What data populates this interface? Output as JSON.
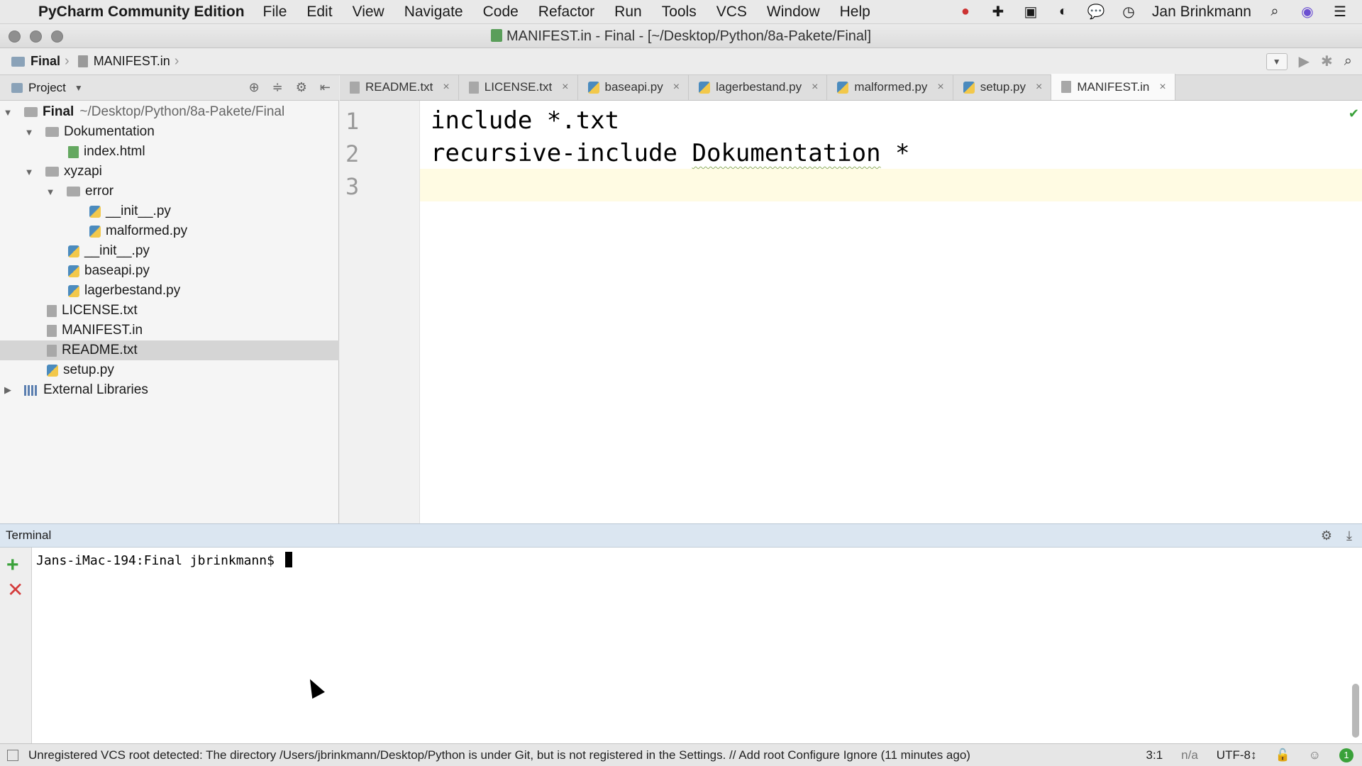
{
  "menubar": {
    "apple": "",
    "app": "PyCharm Community Edition",
    "menus": [
      "File",
      "Edit",
      "View",
      "Navigate",
      "Code",
      "Refactor",
      "Run",
      "Tools",
      "VCS",
      "Window",
      "Help"
    ],
    "user": "Jan Brinkmann"
  },
  "window": {
    "title": "MANIFEST.in - Final - [~/Desktop/Python/8a-Pakete/Final]"
  },
  "navbar": {
    "crumbs": [
      "Final",
      "MANIFEST.in"
    ]
  },
  "project": {
    "header": "Project",
    "tree": [
      {
        "label": "Final",
        "hint": "~/Desktop/Python/8a-Pakete/Final"
      },
      {
        "label": "Dokumentation"
      },
      {
        "label": "index.html"
      },
      {
        "label": "xyzapi"
      },
      {
        "label": "error"
      },
      {
        "label": "__init__.py"
      },
      {
        "label": "malformed.py"
      },
      {
        "label": "__init__.py"
      },
      {
        "label": "baseapi.py"
      },
      {
        "label": "lagerbestand.py"
      },
      {
        "label": "LICENSE.txt"
      },
      {
        "label": "MANIFEST.in"
      },
      {
        "label": "README.txt"
      },
      {
        "label": "setup.py"
      },
      {
        "label": "External Libraries"
      }
    ]
  },
  "tabs": [
    "README.txt",
    "LICENSE.txt",
    "baseapi.py",
    "lagerbestand.py",
    "malformed.py",
    "setup.py",
    "MANIFEST.in"
  ],
  "editor": {
    "line_numbers": [
      "1",
      "2",
      "3"
    ],
    "line1": "include *.txt",
    "line2_start": "recursive-include ",
    "line2_word": "Dokumentation",
    "line2_end": " *"
  },
  "terminal": {
    "title": "Terminal",
    "prompt": "Jans-iMac-194:Final jbrinkmann$ "
  },
  "status": {
    "message": "Unregistered VCS root detected: The directory /Users/jbrinkmann/Desktop/Python is under Git, but is not registered in the Settings. // Add root  Configure  Ignore (11 minutes ago)",
    "position": "3:1",
    "na": "n/a",
    "encoding": "UTF-8↕",
    "notifications": "1"
  }
}
